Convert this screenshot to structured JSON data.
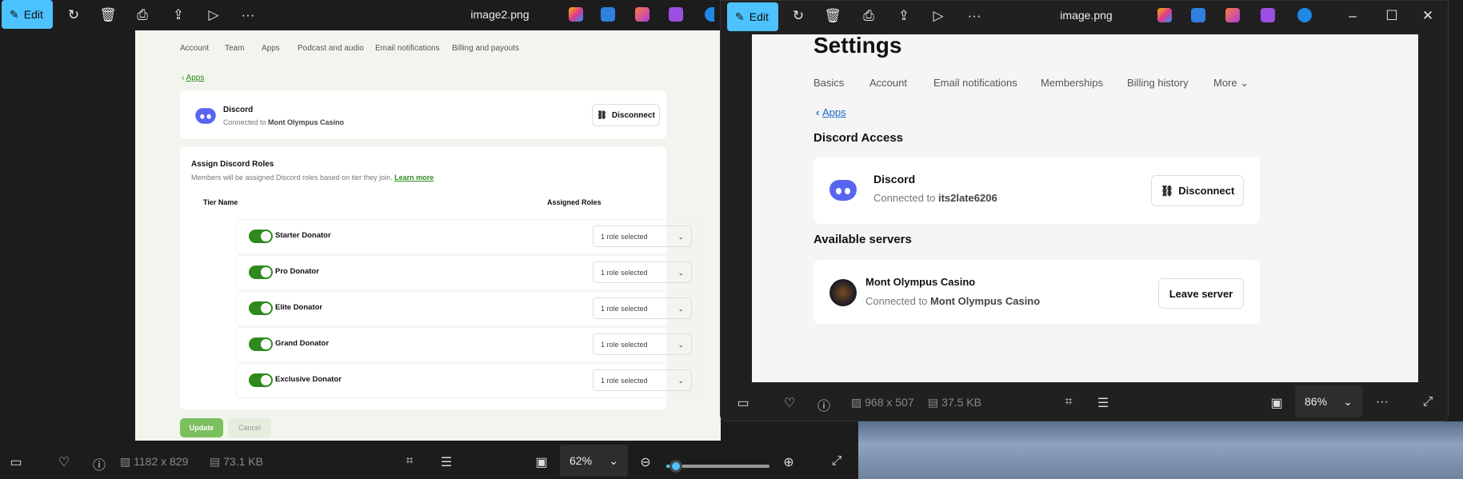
{
  "left_window": {
    "edit_label": "Edit",
    "title": "image2.png",
    "page": {
      "tabs": [
        "Account",
        "Team",
        "Apps",
        "Podcast and audio",
        "Email notifications",
        "Billing and payouts"
      ],
      "back_link": "Apps",
      "integration": {
        "name": "Discord",
        "connected_prefix": "Connected to ",
        "connected_to": "Mont Olympus Casino",
        "disconnect_label": "Disconnect"
      },
      "roles": {
        "title": "Assign Discord Roles",
        "description": "Members will be assigned Discord roles based on tier they join.",
        "learn_more": "Learn more",
        "col_tier": "Tier Name",
        "col_roles": "Assigned Roles",
        "rows": [
          {
            "tier": "Starter Donator",
            "enabled": true,
            "roles": "1 role selected"
          },
          {
            "tier": "Pro Donator",
            "enabled": true,
            "roles": "1 role selected"
          },
          {
            "tier": "Elite Donator",
            "enabled": true,
            "roles": "1 role selected"
          },
          {
            "tier": "Grand Donator",
            "enabled": true,
            "roles": "1 role selected"
          },
          {
            "tier": "Exclusive Donator",
            "enabled": true,
            "roles": "1 role selected"
          }
        ]
      },
      "update_label": "Update",
      "cancel_label": "Cancel"
    },
    "status": {
      "dimensions": "1182 x 829",
      "size": "73.1 KB",
      "zoom": "62%",
      "zoom_slider_percent": 5
    }
  },
  "right_window": {
    "edit_label": "Edit",
    "title": "image.png",
    "page": {
      "heading": "Settings",
      "tabs": [
        "Basics",
        "Account",
        "Email notifications",
        "Memberships",
        "Billing history",
        "More"
      ],
      "back_link": "Apps",
      "section_title": "Discord Access",
      "integration": {
        "name": "Discord",
        "connected_prefix": "Connected to ",
        "connected_to": "its2late6206",
        "disconnect_label": "Disconnect"
      },
      "servers_title": "Available servers",
      "server": {
        "name": "Mont Olympus Casino",
        "connected_prefix": "Connected to ",
        "connected_to": "Mont Olympus Casino",
        "leave_label": "Leave server"
      }
    },
    "status": {
      "dimensions": "968 x 507",
      "size": "37.5 KB",
      "zoom": "86%"
    }
  }
}
